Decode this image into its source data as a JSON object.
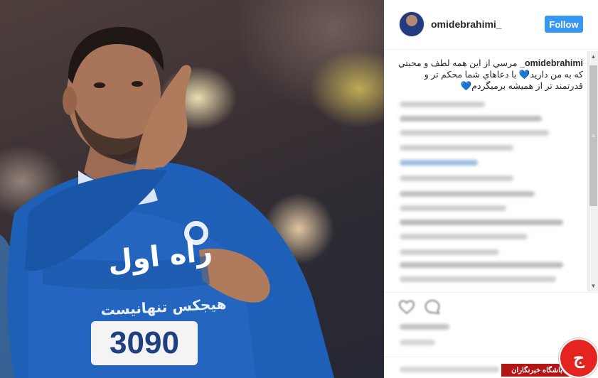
{
  "post": {
    "username": "omidebrahimi_",
    "follow_label": "Follow",
    "caption_user": "omidebrahimi_",
    "caption_text": "مرسي از اين همه لطف و محبتي كه به من داريد💙 با دعاهاي شما محكم تر و قدرتمند تر از هميشه برميگردم💙"
  },
  "photo": {
    "jersey_sponsor": "هیجکس تنهانیست",
    "jersey_brand": "راه اول",
    "jersey_number_text": "3090"
  },
  "watermark": {
    "logo_letter": "ج",
    "label": "باشگاه خبرنگاران"
  },
  "colors": {
    "follow_button": "#3897f0",
    "jersey_blue": "#1e5fb8",
    "watermark_red": "#e52321"
  },
  "icons": {
    "heart": "heart-icon",
    "comment": "comment-icon",
    "scroll_up": "scroll-up-icon",
    "scroll_down": "scroll-down-icon"
  }
}
